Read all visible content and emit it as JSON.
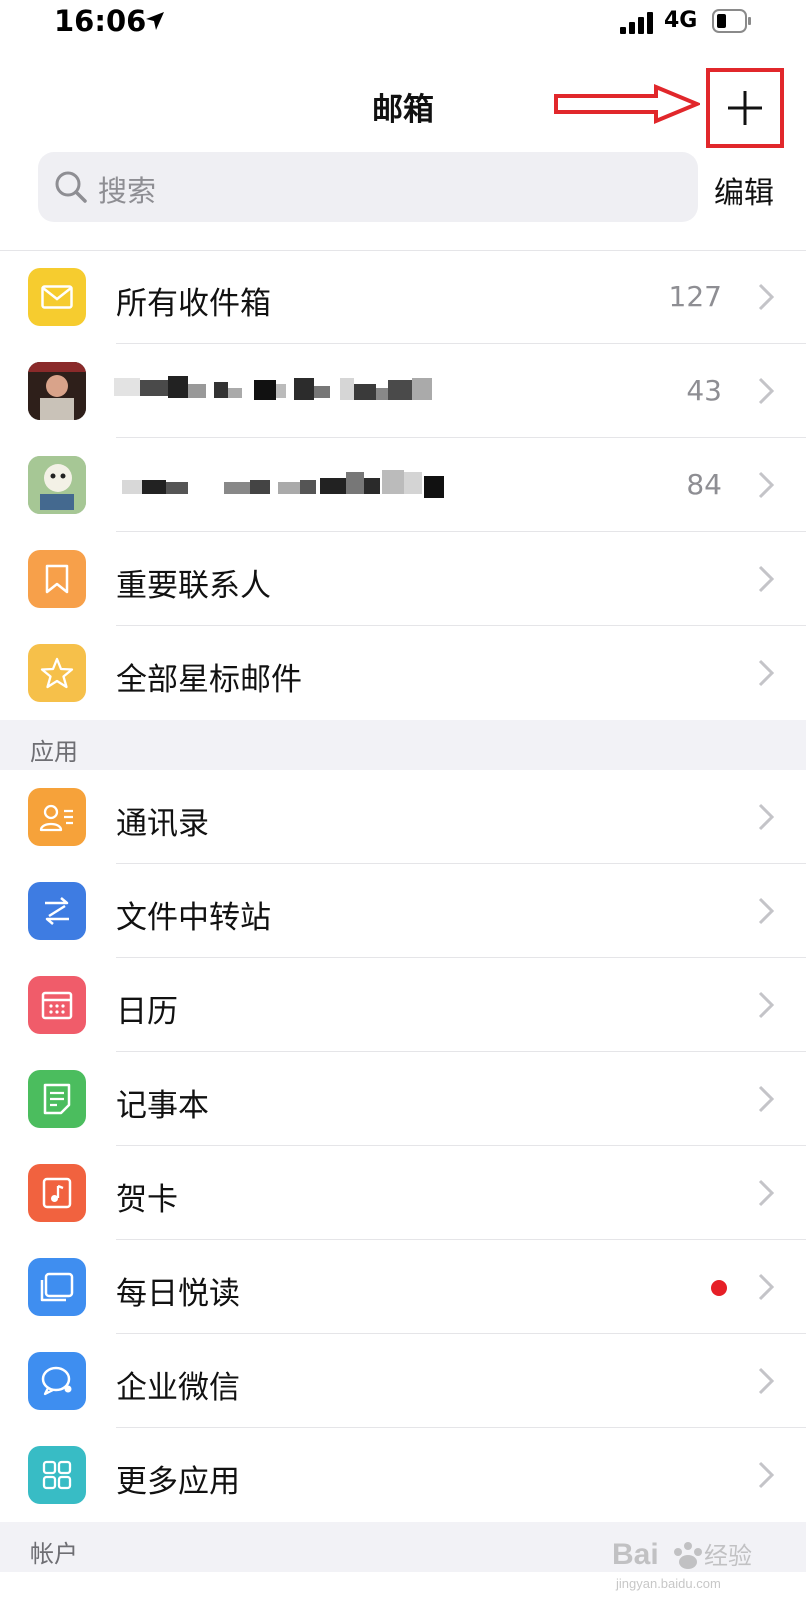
{
  "status_bar": {
    "time": "16:06",
    "network": "4G"
  },
  "nav": {
    "title": "邮箱",
    "edit_label": "编辑"
  },
  "search": {
    "placeholder": "搜索"
  },
  "mail_rows": [
    {
      "label": "所有收件箱",
      "count": "127",
      "icon": "mail-icon",
      "color": "#f6cc2f"
    },
    {
      "label": "",
      "count": "43",
      "icon": "avatar",
      "obscured": true
    },
    {
      "label": "",
      "count": "84",
      "icon": "avatar",
      "obscured": true
    },
    {
      "label": "重要联系人",
      "count": "",
      "icon": "bookmark-icon",
      "color": "#f7a04a"
    },
    {
      "label": "全部星标邮件",
      "count": "",
      "icon": "star-icon",
      "color": "#f6c04a"
    }
  ],
  "sections": {
    "apps": "应用",
    "account": "帐户"
  },
  "app_rows": [
    {
      "label": "通讯录",
      "icon": "contacts-icon",
      "color": "#f6a23a"
    },
    {
      "label": "文件中转站",
      "icon": "file-transfer-icon",
      "color": "#3e7ce2"
    },
    {
      "label": "日历",
      "icon": "calendar-icon",
      "color": "#f05c6a"
    },
    {
      "label": "记事本",
      "icon": "notepad-icon",
      "color": "#4bbd5e"
    },
    {
      "label": "贺卡",
      "icon": "greeting-card-icon",
      "color": "#f1623f"
    },
    {
      "label": "每日悦读",
      "icon": "reading-icon",
      "color": "#3f8ef0",
      "badge": "red-dot"
    },
    {
      "label": "企业微信",
      "icon": "wecom-icon",
      "color": "#3e8ef0"
    },
    {
      "label": "更多应用",
      "icon": "more-apps-icon",
      "color": "#38bcc5"
    }
  ],
  "watermark": {
    "text": "Bai",
    "text2": "经验",
    "url": "jingyan.baidu.com"
  }
}
